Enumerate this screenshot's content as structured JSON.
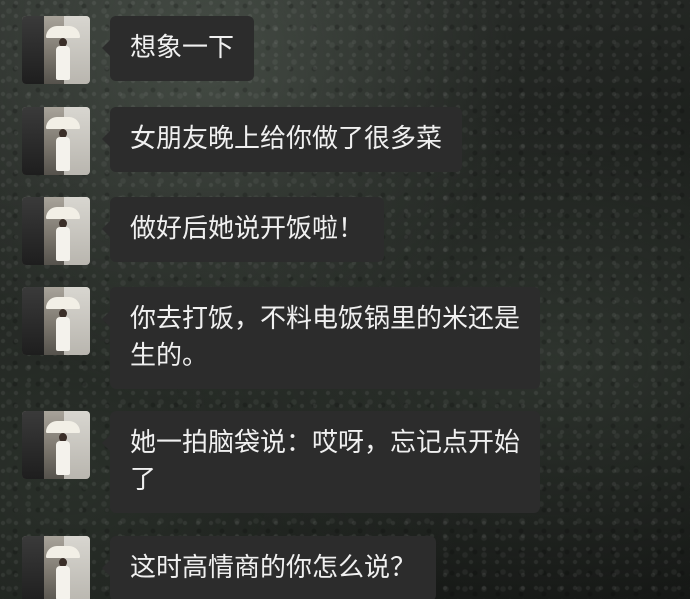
{
  "messages": [
    {
      "text": "想象一下",
      "avatar_icon": "contact-avatar"
    },
    {
      "text": "女朋友晚上给你做了很多菜",
      "avatar_icon": "contact-avatar"
    },
    {
      "text": "做好后她说开饭啦！",
      "avatar_icon": "contact-avatar"
    },
    {
      "text": "你去打饭，不料电饭锅里的米还是\n生的。",
      "avatar_icon": "contact-avatar"
    },
    {
      "text": "她一拍脑袋说：哎呀，忘记点开始\n了",
      "avatar_icon": "contact-avatar"
    },
    {
      "text": "这时高情商的你怎么说？",
      "avatar_icon": "contact-avatar"
    }
  ],
  "colors": {
    "bubble": "#2c2c2c",
    "text": "#f0f0f0"
  }
}
